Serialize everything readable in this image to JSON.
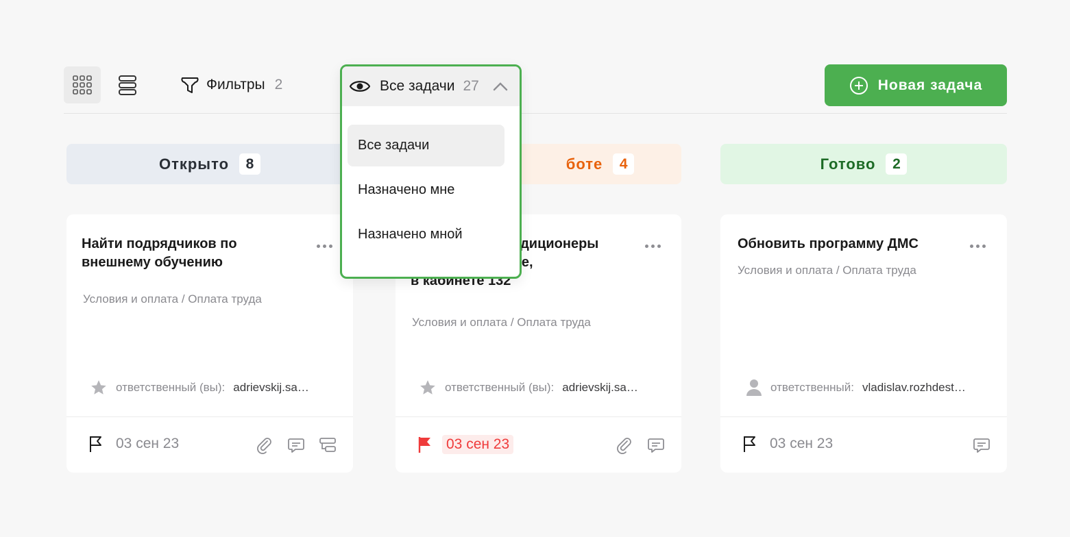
{
  "toolbar": {
    "filters_label": "Фильтры",
    "filters_count": "2",
    "new_task_label": "Новая задача"
  },
  "view_dropdown": {
    "selected_label": "Все задачи",
    "selected_count": "27",
    "options": [
      "Все задачи",
      "Назначено мне",
      "Назначено мной"
    ]
  },
  "columns": [
    {
      "title": "Открыто",
      "count": "8",
      "card": {
        "title": "Найти подрядчиков по внешнему обучению",
        "path": "Условия и оплата / Оплата труда",
        "assignee_label": "ответственный (вы):",
        "assignee_value": "adrievskij.sa…",
        "date": "03 сен 23"
      }
    },
    {
      "title_visible": "боте",
      "count": "4",
      "card": {
        "title_visible_line1": "ндиционеры",
        "title_visible_line2": "же,",
        "title_visible_line3": "в кабинете 132",
        "path": "Условия и оплата / Оплата труда",
        "assignee_label": "ответственный (вы):",
        "assignee_value": "adrievskij.sa…",
        "date": "03 сен 23"
      }
    },
    {
      "title": "Готово",
      "count": "2",
      "card": {
        "title": "Обновить программу ДМС",
        "path": "Условия и оплата / Оплата труда",
        "assignee_label": "ответственный:",
        "assignee_value": "vladislav.rozhdest…",
        "date": "03 сен 23"
      }
    }
  ],
  "colors": {
    "accent_green": "#4caf50",
    "overdue_red": "#ef3b3b",
    "in_progress_orange": "#e8620c"
  }
}
